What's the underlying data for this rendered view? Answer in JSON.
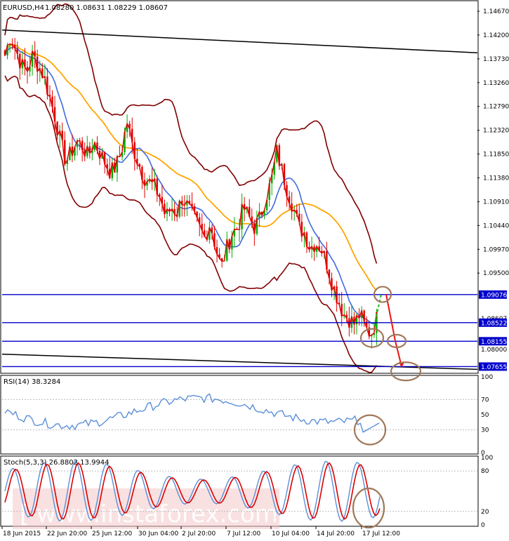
{
  "header": {
    "symbol": "EURUSD,H4",
    "quote": "1.08280 1.08631 1.08229 1.08607"
  },
  "colors": {
    "price_line": "#0000cc",
    "candle_up": "#00aa00",
    "candle_down": "#e00000",
    "bollinger": "#800000",
    "ma_slow": "#ffa500",
    "ma_fast": "#4169e1",
    "trendline": "#000000",
    "annotation": "#a0785a",
    "rsi_line": "#5b8fd8",
    "stoch_main": "#5b8fd8",
    "stoch_signal": "#dd0000",
    "watermark_bg": "#f4c9c9"
  },
  "main": {
    "y_labels": [
      "1.14670",
      "1.14200",
      "1.13730",
      "1.13260",
      "1.12790",
      "1.12320",
      "1.11850",
      "1.11380",
      "1.10910",
      "1.10440",
      "1.09970",
      "1.09500"
    ],
    "levels": [
      {
        "label": "1.09076",
        "value": 1.09076
      },
      {
        "label": "1.08607",
        "value": 1.08607
      },
      {
        "label": "1.08522",
        "value": 1.08522
      },
      {
        "label": "1.08155",
        "value": 1.08155
      },
      {
        "label": "1.07655",
        "value": 1.07655
      }
    ],
    "extra_label": "1.08000"
  },
  "rsi": {
    "title": "RSI(14) 38.3284",
    "y_labels": [
      "100",
      "70",
      "50",
      "30",
      "0"
    ]
  },
  "stoch": {
    "title": "Stoch(5,3,3) 26.8802 13.9944",
    "y_labels": [
      "100",
      "80",
      "20",
      "0"
    ]
  },
  "x_labels": [
    "18 Jun 2015",
    "22 Jun 20:00",
    "25 Jun 12:00",
    "30 Jun 04:00",
    "2 Jul 20:00",
    "7 Jul 12:00",
    "10 Jul 04:00",
    "14 Jul 20:00",
    "17 Jul 12:00"
  ],
  "watermark": "[ www.instaforex.com ]",
  "chart_data": {
    "type": "candlestick",
    "symbol": "EURUSD",
    "timeframe": "H4",
    "ylim": [
      1.0755,
      1.1485
    ],
    "close_path": [
      1.138,
      1.142,
      1.139,
      1.136,
      1.135,
      1.138,
      1.136,
      1.134,
      1.13,
      1.126,
      1.121,
      1.117,
      1.119,
      1.121,
      1.12,
      1.118,
      1.121,
      1.119,
      1.117,
      1.115,
      1.116,
      1.119,
      1.125,
      1.12,
      1.117,
      1.114,
      1.113,
      1.112,
      1.11,
      1.106,
      1.108,
      1.107,
      1.11,
      1.108,
      1.106,
      1.104,
      1.102,
      1.105,
      1.1,
      1.096,
      1.1,
      1.103,
      1.104,
      1.108,
      1.106,
      1.104,
      1.106,
      1.11,
      1.113,
      1.119,
      1.115,
      1.111,
      1.108,
      1.104,
      1.103,
      1.1,
      1.101,
      1.1,
      1.097,
      1.093,
      1.09,
      1.087,
      1.086,
      1.085,
      1.087,
      1.084,
      1.083,
      1.086
    ],
    "forecast_points": [
      1.0908,
      1.0816,
      1.0766
    ]
  }
}
